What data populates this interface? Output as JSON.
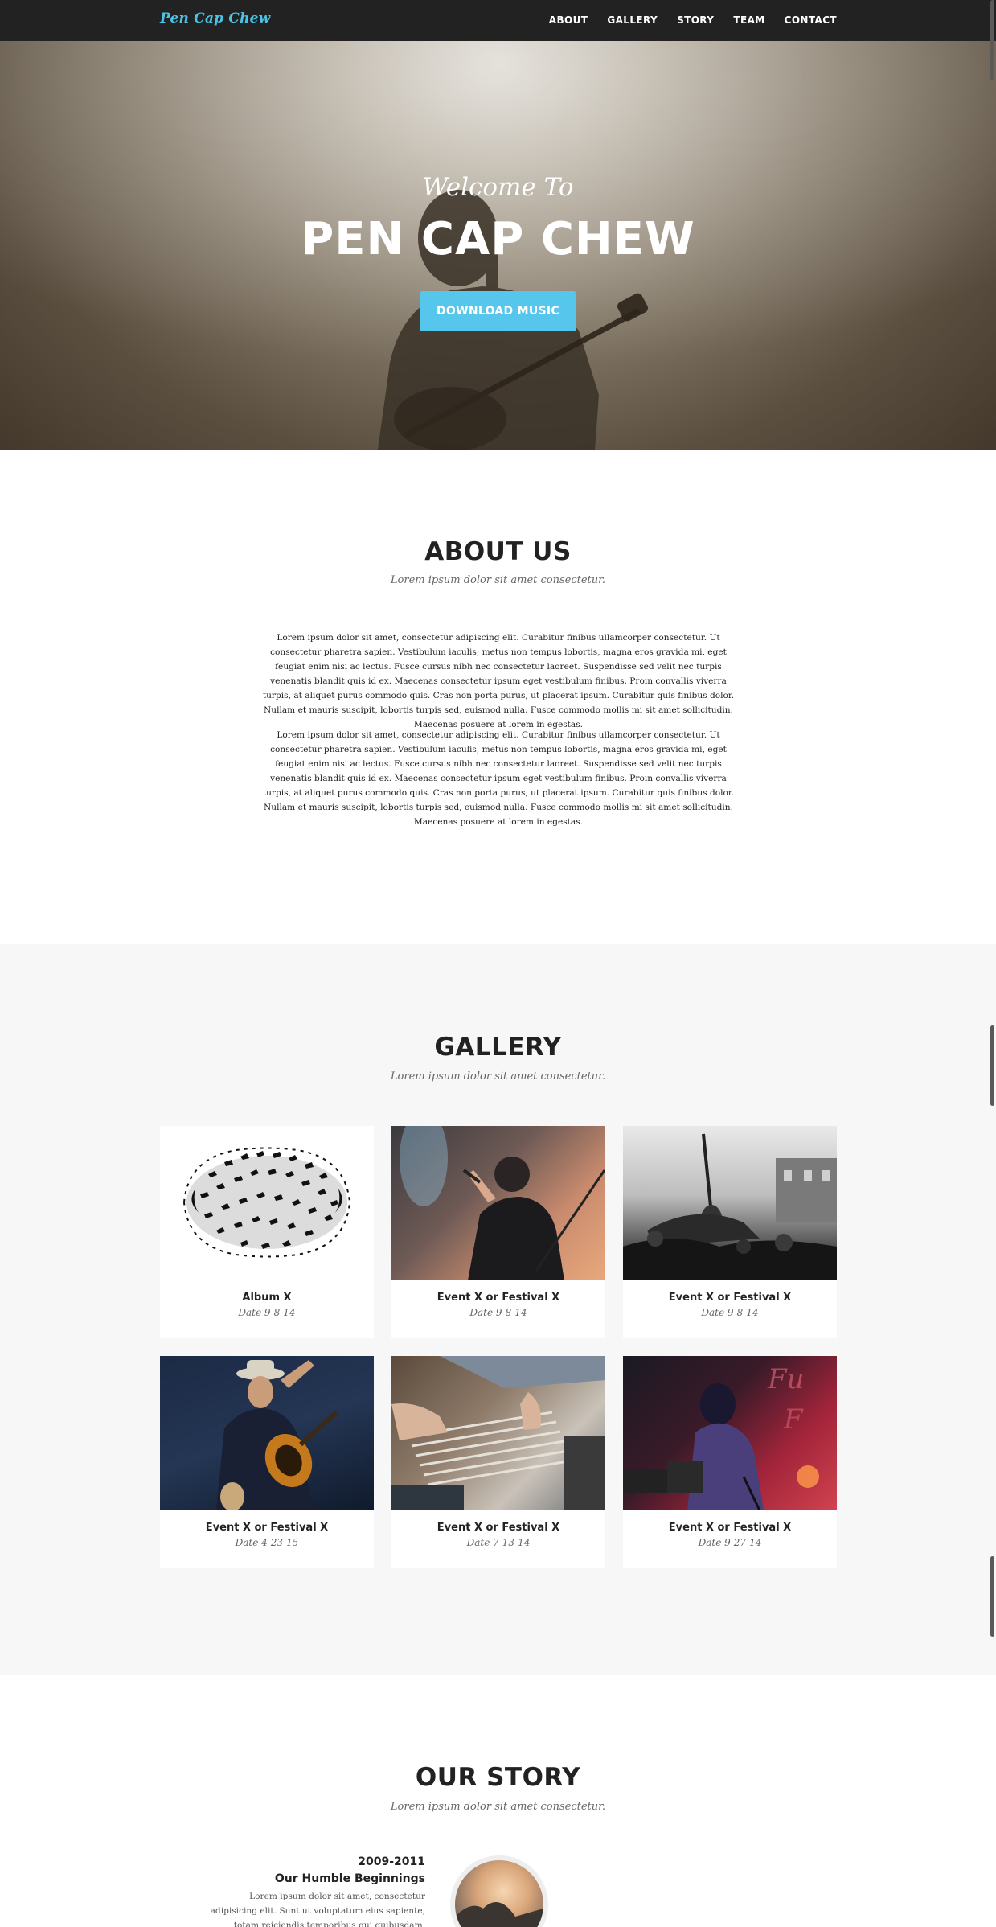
{
  "nav": {
    "brand": "Pen Cap Chew",
    "links": [
      "ABOUT",
      "GALLERY",
      "STORY",
      "TEAM",
      "CONTACT"
    ]
  },
  "hero": {
    "subtitle": "Welcome To",
    "title": "PEN CAP CHEW",
    "button": "DOWNLOAD MUSIC"
  },
  "about": {
    "title": "ABOUT US",
    "subtitle": "Lorem ipsum dolor sit amet consectetur.",
    "paragraphs": [
      "Lorem ipsum dolor sit amet, consectetur adipiscing elit. Curabitur finibus ullamcorper consectetur. Ut consectetur pharetra sapien. Vestibulum iaculis, metus non tempus lobortis, magna eros gravida mi, eget feugiat enim nisi ac lectus. Fusce cursus nibh nec consectetur laoreet. Suspendisse sed velit nec turpis venenatis blandit quis id ex. Maecenas consectetur ipsum eget vestibulum finibus. Proin convallis viverra turpis, at aliquet purus commodo quis. Cras non porta purus, ut placerat ipsum. Curabitur quis finibus dolor. Nullam et mauris suscipit, lobortis turpis sed, euismod nulla. Fusce commodo mollis mi sit amet sollicitudin. Maecenas posuere at lorem in egestas.",
      "Lorem ipsum dolor sit amet, consectetur adipiscing elit. Curabitur finibus ullamcorper consectetur. Ut consectetur pharetra sapien. Vestibulum iaculis, metus non tempus lobortis, magna eros gravida mi, eget feugiat enim nisi ac lectus. Fusce cursus nibh nec consectetur laoreet. Suspendisse sed velit nec turpis venenatis blandit quis id ex. Maecenas consectetur ipsum eget vestibulum finibus. Proin convallis viverra turpis, at aliquet purus commodo quis. Cras non porta purus, ut placerat ipsum. Curabitur quis finibus dolor. Nullam et mauris suscipit, lobortis turpis sed, euismod nulla. Fusce commodo mollis mi sit amet sollicitudin. Maecenas posuere at lorem in egestas."
    ]
  },
  "gallery": {
    "title": "GALLERY",
    "subtitle": "Lorem ipsum dolor sit amet consectetur.",
    "items": [
      {
        "title": "Album X",
        "date": "Date 9-8-14"
      },
      {
        "title": "Event X or Festival X",
        "date": "Date 9-8-14"
      },
      {
        "title": "Event X or Festival X",
        "date": "Date 9-8-14"
      },
      {
        "title": "Event X or Festival X",
        "date": "Date 4-23-15"
      },
      {
        "title": "Event X or Festival X",
        "date": "Date 7-13-14"
      },
      {
        "title": "Event X or Festival X",
        "date": "Date 9-27-14"
      }
    ]
  },
  "story": {
    "title": "OUR STORY",
    "subtitle": "Lorem ipsum dolor sit amet consectetur.",
    "entry_year": "2009-2011",
    "entry_heading": "Our Humble Beginnings",
    "entry_text": "Lorem ipsum dolor sit amet, consectetur adipisicing elit. Sunt ut voluptatum eius sapiente, totam reiciendis temporibus qui quibusdam, recusandae"
  },
  "colors": {
    "accent": "#56c6ed",
    "brand": "#4cc3e6",
    "nav_bg": "#222222",
    "gallery_bg": "#f7f7f7"
  }
}
